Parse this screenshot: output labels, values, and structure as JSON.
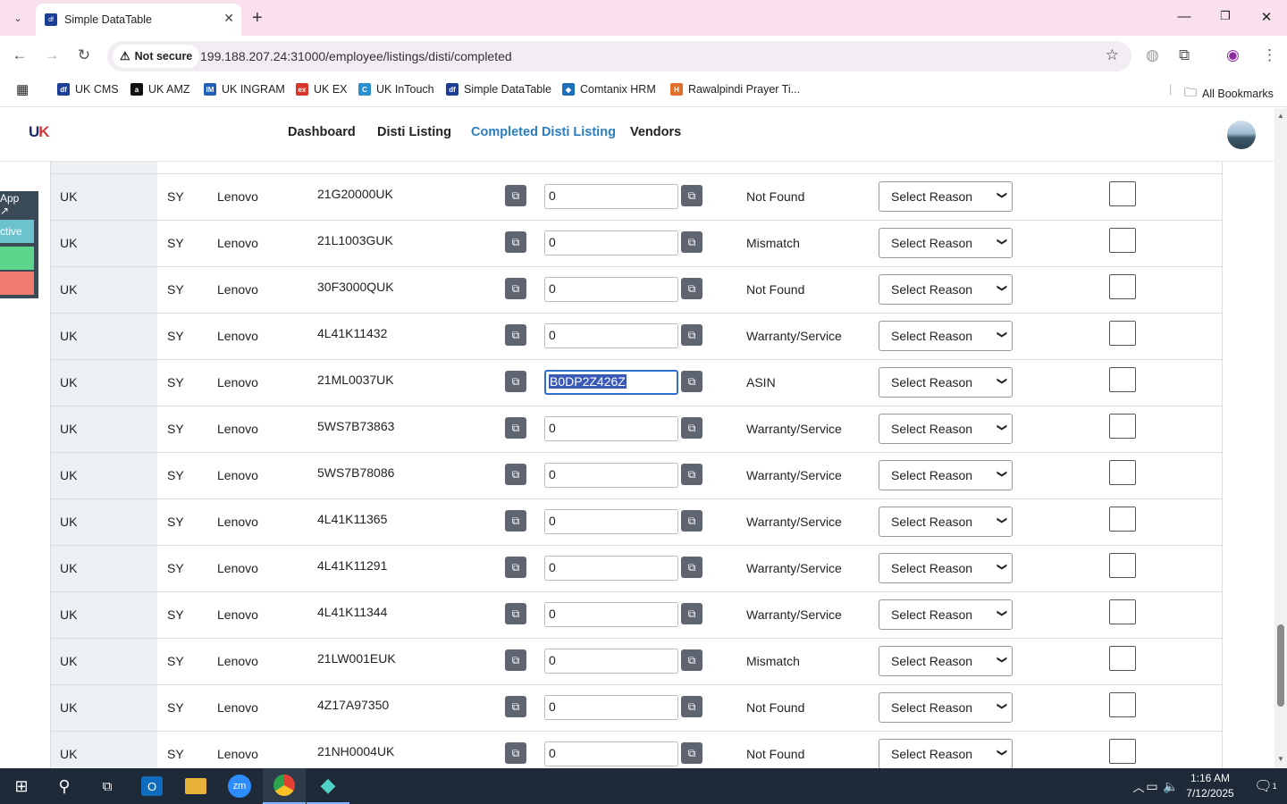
{
  "browser": {
    "tab_title": "Simple DataTable",
    "tab_favicon": "df",
    "security_label": "Not secure",
    "url": "199.188.207.24:31000/employee/listings/disti/completed",
    "bookmarks": [
      {
        "label": "UK CMS",
        "icon": "df",
        "color": "#1c3f95"
      },
      {
        "label": "UK AMZ",
        "icon": "a",
        "color": "#111111"
      },
      {
        "label": "UK INGRAM",
        "icon": "IM",
        "color": "#1f5fb8"
      },
      {
        "label": "UK EX",
        "icon": "ex",
        "color": "#d9342b"
      },
      {
        "label": "UK InTouch",
        "icon": "C",
        "color": "#2a8fd0"
      },
      {
        "label": "Simple DataTable",
        "icon": "df",
        "color": "#1c3f95"
      },
      {
        "label": "Comtanix HRM",
        "icon": "◆",
        "color": "#1d6fb7"
      },
      {
        "label": "Rawalpindi Prayer Ti...",
        "icon": "H",
        "color": "#e0702a"
      }
    ],
    "all_bookmarks": "All Bookmarks"
  },
  "app": {
    "logo_main": "U",
    "logo_accent": "K",
    "nav": [
      "Dashboard",
      "Disti Listing",
      "Completed Disti Listing",
      "Vendors"
    ]
  },
  "sidepanel": {
    "items": [
      "App ↗",
      "ctive",
      "",
      ""
    ]
  },
  "table": {
    "rows": [
      {
        "country": "UK",
        "code": "SY",
        "brand": "Lenovo",
        "sku": "21G20000UK",
        "value": "0",
        "status": "Not Found",
        "reason": "Select Reason"
      },
      {
        "country": "UK",
        "code": "SY",
        "brand": "Lenovo",
        "sku": "21L1003GUK",
        "value": "0",
        "status": "Mismatch",
        "reason": "Select Reason"
      },
      {
        "country": "UK",
        "code": "SY",
        "brand": "Lenovo",
        "sku": "30F3000QUK",
        "value": "0",
        "status": "Not Found",
        "reason": "Select Reason"
      },
      {
        "country": "UK",
        "code": "SY",
        "brand": "Lenovo",
        "sku": "4L41K11432",
        "value": "0",
        "status": "Warranty/Service",
        "reason": "Select Reason"
      },
      {
        "country": "UK",
        "code": "SY",
        "brand": "Lenovo",
        "sku": "21ML0037UK",
        "value": "B0DP2Z426Z",
        "status": "ASIN",
        "reason": "Select Reason",
        "focused": true
      },
      {
        "country": "UK",
        "code": "SY",
        "brand": "Lenovo",
        "sku": "5WS7B73863",
        "value": "0",
        "status": "Warranty/Service",
        "reason": "Select Reason"
      },
      {
        "country": "UK",
        "code": "SY",
        "brand": "Lenovo",
        "sku": "5WS7B78086",
        "value": "0",
        "status": "Warranty/Service",
        "reason": "Select Reason"
      },
      {
        "country": "UK",
        "code": "SY",
        "brand": "Lenovo",
        "sku": "4L41K11365",
        "value": "0",
        "status": "Warranty/Service",
        "reason": "Select Reason"
      },
      {
        "country": "UK",
        "code": "SY",
        "brand": "Lenovo",
        "sku": "4L41K11291",
        "value": "0",
        "status": "Warranty/Service",
        "reason": "Select Reason"
      },
      {
        "country": "UK",
        "code": "SY",
        "brand": "Lenovo",
        "sku": "4L41K11344",
        "value": "0",
        "status": "Warranty/Service",
        "reason": "Select Reason"
      },
      {
        "country": "UK",
        "code": "SY",
        "brand": "Lenovo",
        "sku": "21LW001EUK",
        "value": "0",
        "status": "Mismatch",
        "reason": "Select Reason"
      },
      {
        "country": "UK",
        "code": "SY",
        "brand": "Lenovo",
        "sku": "4Z17A97350",
        "value": "0",
        "status": "Not Found",
        "reason": "Select Reason"
      },
      {
        "country": "UK",
        "code": "SY",
        "brand": "Lenovo",
        "sku": "21NH0004UK",
        "value": "0",
        "status": "Not Found",
        "reason": "Select Reason"
      }
    ]
  },
  "taskbar": {
    "time": "1:16 AM",
    "date": "7/12/2025",
    "notifications": "1"
  },
  "colors": {
    "accent": "#2a7ec0",
    "copy_button": "#5f6570",
    "focus": "#2f6fd1"
  }
}
